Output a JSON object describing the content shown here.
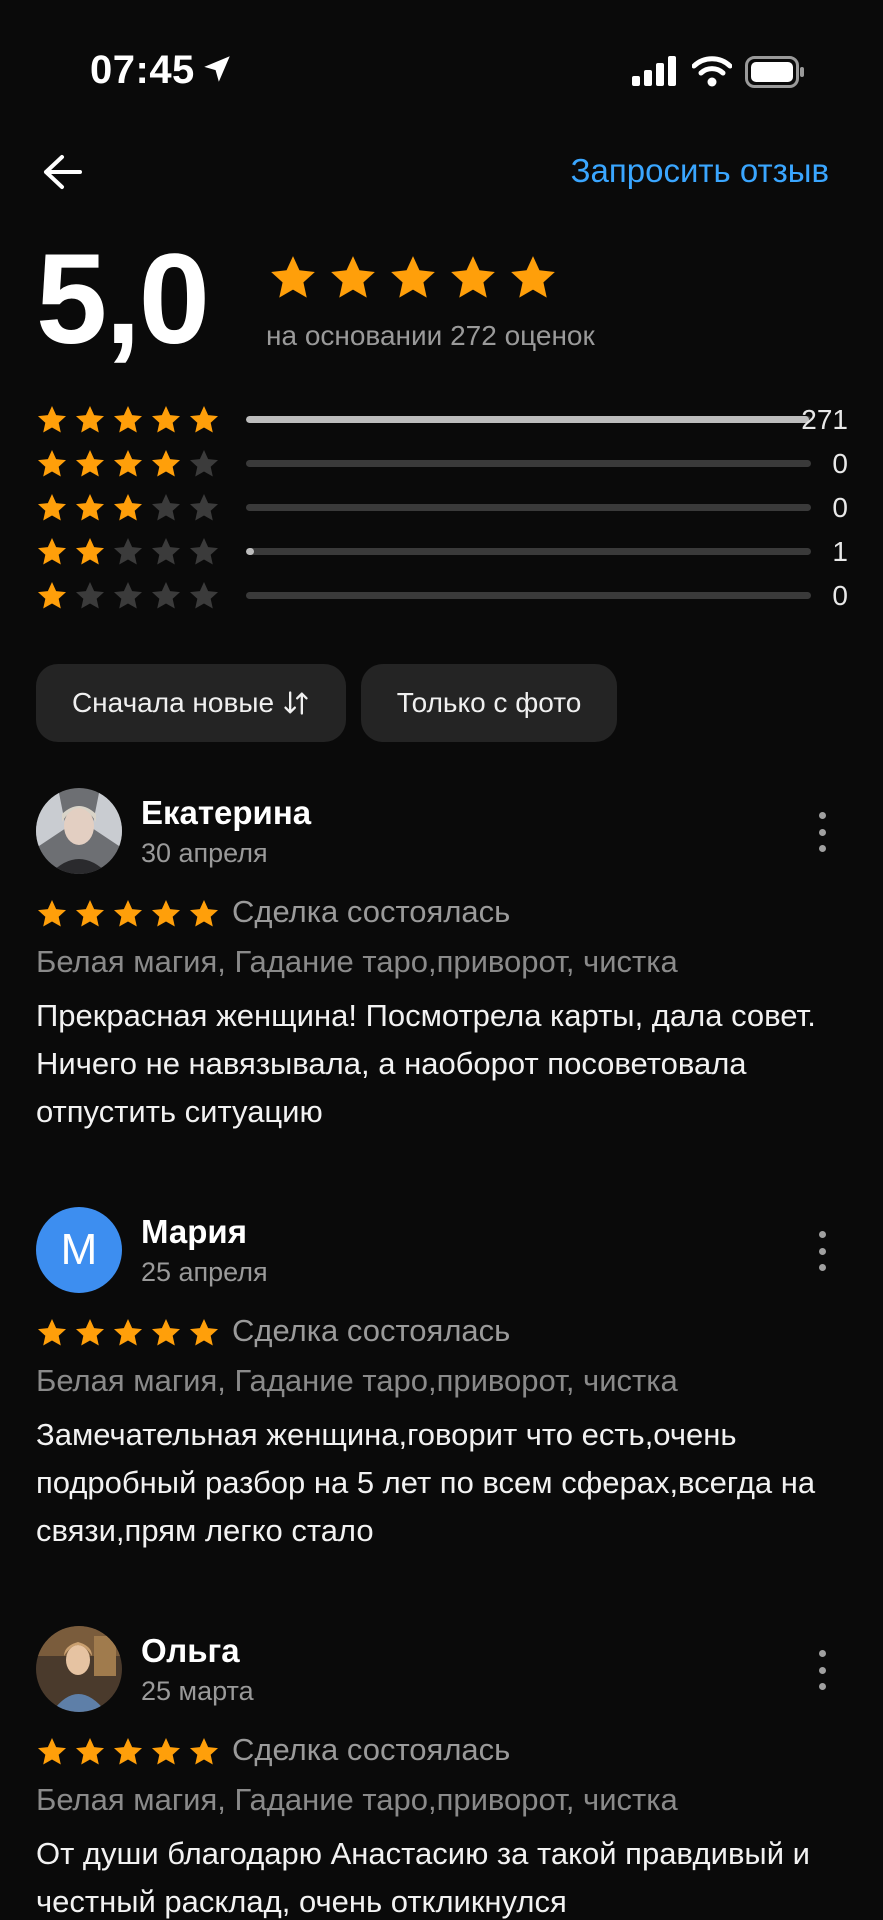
{
  "status": {
    "time": "07:45"
  },
  "header": {
    "request_review": "Запросить отзыв"
  },
  "summary": {
    "rating": "5,0",
    "based_on": "на основании 272 оценок",
    "distribution": [
      {
        "stars": 5,
        "count": "271",
        "fraction": 0.996
      },
      {
        "stars": 4,
        "count": "0",
        "fraction": 0
      },
      {
        "stars": 3,
        "count": "0",
        "fraction": 0
      },
      {
        "stars": 2,
        "count": "1",
        "fraction": 0.004
      },
      {
        "stars": 1,
        "count": "0",
        "fraction": 0
      }
    ]
  },
  "filters": {
    "sort": "Сначала новые",
    "photo": "Только с фото"
  },
  "colors": {
    "star": "#ff9f0a",
    "star_empty": "#3b3b3b",
    "link": "#3aa6ff",
    "avatar_m": "#3d8ef0"
  },
  "reviews": [
    {
      "author": "Екатерина",
      "date": "30 апреля",
      "deal": "Сделка состоялась",
      "categories": "Белая магия, Гадание таро,приворот, чистка",
      "text": "Прекрасная женщина! Посмотрела карты, дала совет. Ничего не навязывала, а наоборот посоветовала отпустить ситуацию"
    },
    {
      "author": "Мария",
      "date": "25 апреля",
      "initial": "М",
      "deal": "Сделка состоялась",
      "categories": "Белая магия, Гадание таро,приворот, чистка",
      "text": "Замечательная женщина,говорит что есть,очень подробный разбор на 5 лет по всем сферах,всегда на связи,прям легко стало"
    },
    {
      "author": "Ольга",
      "date": "25 марта",
      "deal": "Сделка состоялась",
      "categories": "Белая магия, Гадание таро,приворот, чистка",
      "text": "От души благодарю Анастасию за такой правдивый и честный расклад, очень откликнулся"
    }
  ]
}
